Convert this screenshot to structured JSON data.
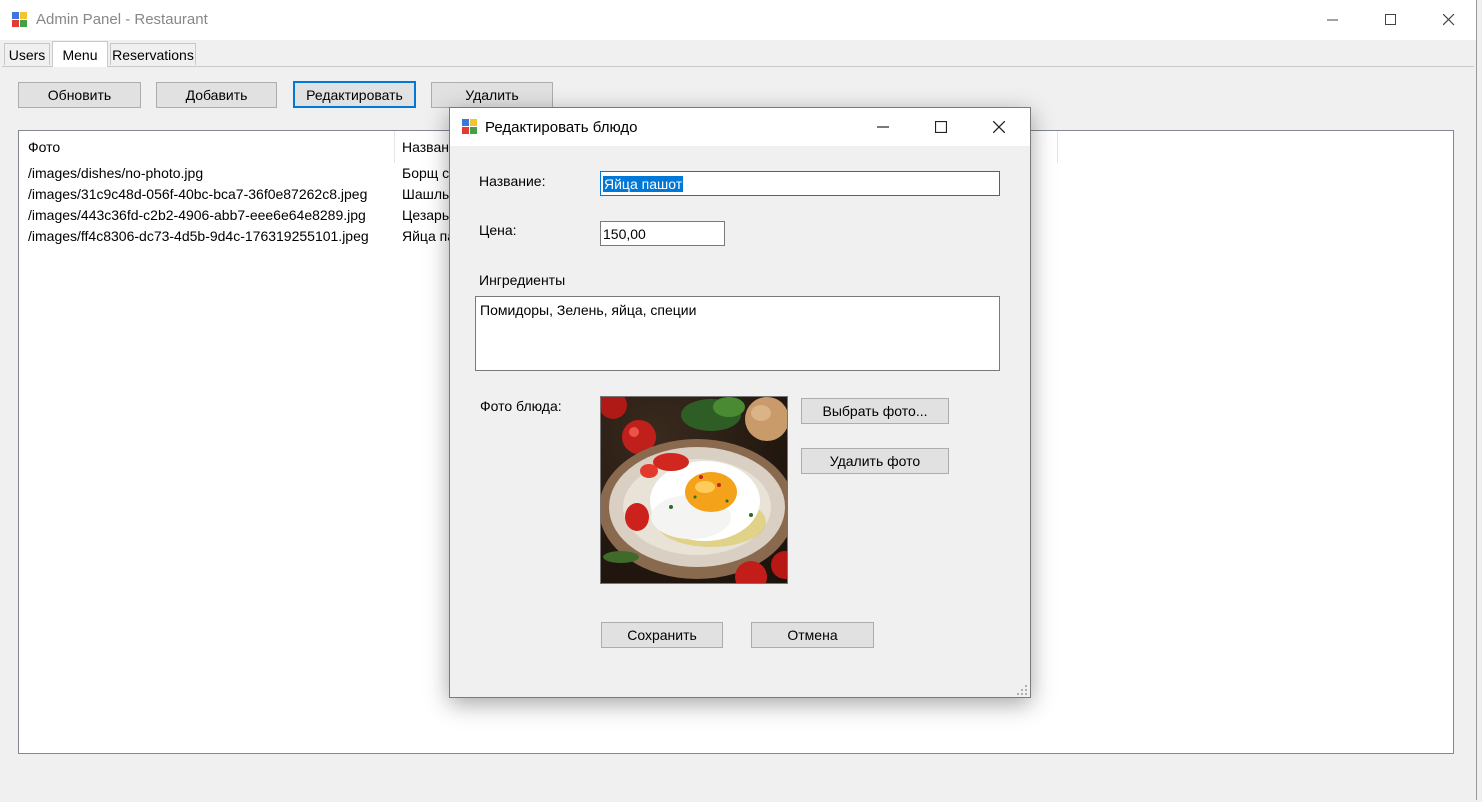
{
  "window": {
    "title": "Admin Panel - Restaurant",
    "minimize_glyph": "—",
    "maximize_glyph": "☐",
    "close_glyph": "✕"
  },
  "tabs": [
    {
      "label": "Users",
      "active": false
    },
    {
      "label": "Menu",
      "active": true
    },
    {
      "label": "Reservations",
      "active": false
    }
  ],
  "toolbar": {
    "refresh_label": "Обновить",
    "add_label": "Добавить",
    "edit_label": "Редактировать",
    "delete_label": "Удалить"
  },
  "table": {
    "columns": [
      "Фото",
      "Названи"
    ],
    "rows": [
      {
        "photo": "/images/dishes/no-photo.jpg",
        "name": "Борщ с"
      },
      {
        "photo": "/images/31c9c48d-056f-40bc-bca7-36f0e87262c8.jpeg",
        "name": "Шашлы"
      },
      {
        "photo": "/images/443c36fd-c2b2-4906-abb7-eee6e64e8289.jpg",
        "name": "Цезарь"
      },
      {
        "photo": "/images/ff4c8306-dc73-4d5b-9d4c-176319255101.jpeg",
        "name": "Яйца па"
      }
    ]
  },
  "dialog": {
    "title": "Редактировать блюдо",
    "name_label": "Название:",
    "name_value": "Яйца пашот",
    "price_label": "Цена:",
    "price_value": "150,00",
    "ingredients_label": "Ингредиенты",
    "ingredients_value": "Помидоры, Зелень, яйца, специи",
    "photo_label": "Фото блюда:",
    "choose_photo_label": "Выбрать фото...",
    "delete_photo_label": "Удалить фото",
    "save_label": "Сохранить",
    "cancel_label": "Отмена",
    "photo_icon": "poached-egg-dish-photo"
  },
  "colors": {
    "accent": "#0078d7",
    "window_bg": "#f0f0f0",
    "button_bg": "#e1e1e1"
  }
}
